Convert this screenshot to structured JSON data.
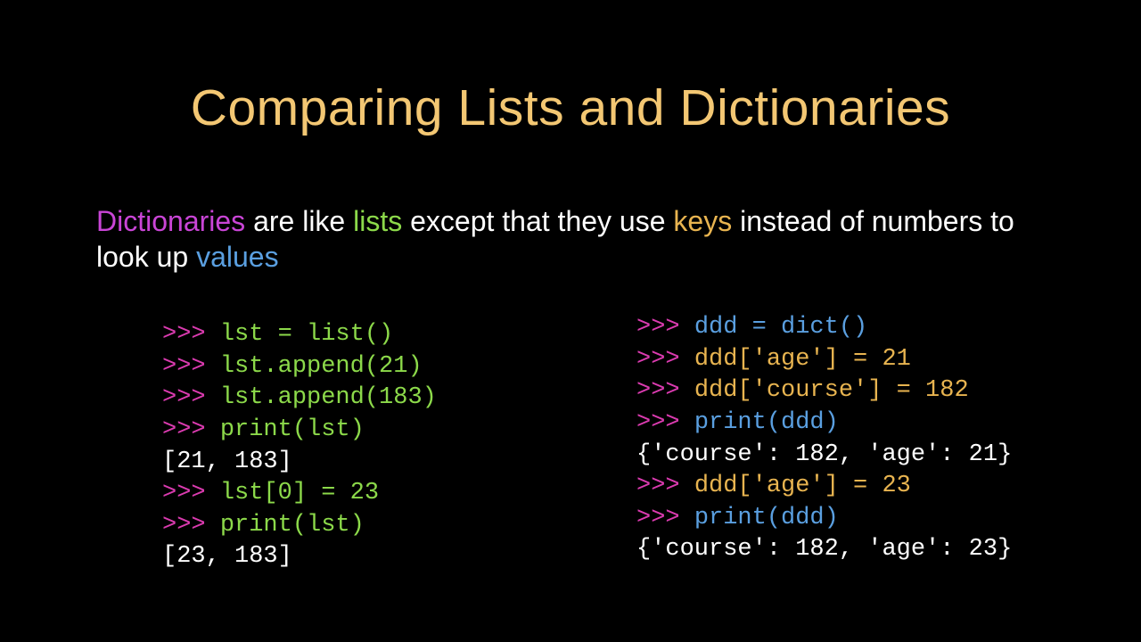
{
  "title": "Comparing Lists and Dictionaries",
  "subtitle": {
    "w1": "Dictionaries",
    "w2": " are like ",
    "w3": "lists",
    "w4": " except that they use ",
    "w5": "keys",
    "w6": " instead of numbers to look up ",
    "w7": "values"
  },
  "prompt": ">>> ",
  "left": {
    "l1": "lst = list()",
    "l2": "lst.append(21)",
    "l3": "lst.append(183)",
    "l4": "print(lst)",
    "o1": "[21, 183]",
    "l5": "lst[0] = 23",
    "l6": "print(lst)",
    "o2": "[23, 183]"
  },
  "right": {
    "l1": "ddd = dict()",
    "l2": "ddd['age'] = 21",
    "l3": "ddd['course'] = 182",
    "l4": "print(ddd)",
    "o1": "{'course': 182, 'age': 21}",
    "l5": "ddd['age'] = 23",
    "l6": "print(ddd)",
    "o2": "{'course': 182, 'age': 23}"
  }
}
